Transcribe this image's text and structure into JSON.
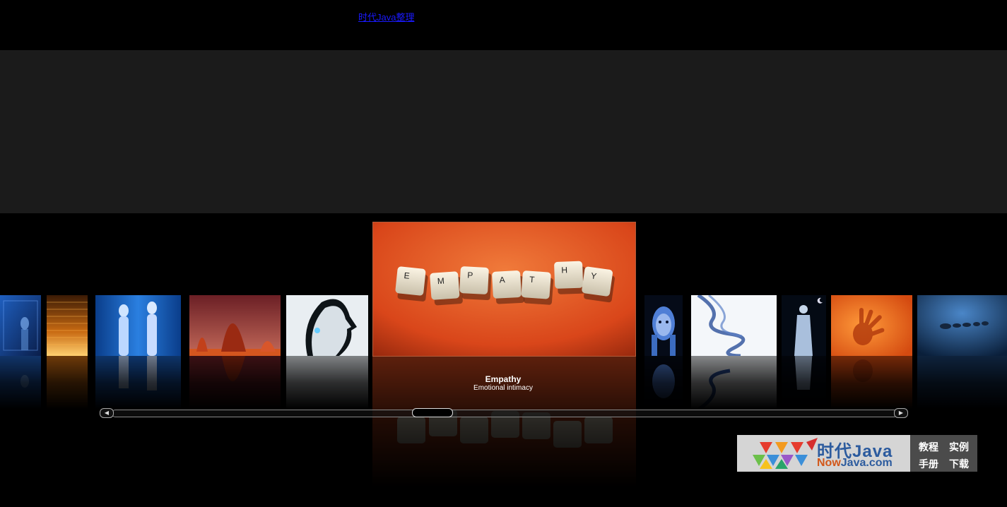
{
  "header": {
    "link_text": "时代Java整理"
  },
  "gallery": {
    "items": [
      {
        "name": "blue-glass-figure-thumbnail"
      },
      {
        "name": "orange-code-thumbnail"
      },
      {
        "name": "blue-mannequins-thumbnail"
      },
      {
        "name": "red-cone-landscape-thumbnail"
      },
      {
        "name": "white-face-profile-thumbnail"
      },
      {
        "name": "empathy-keys-thumbnail"
      },
      {
        "name": "blue-face-hands-thumbnail"
      },
      {
        "name": "blue-smoke-thumbnail"
      },
      {
        "name": "ghost-figure-thumbnail"
      },
      {
        "name": "orange-hand-thumbnail"
      },
      {
        "name": "blue-stones-thumbnail"
      }
    ],
    "selected": {
      "title": "Empathy",
      "subtitle": "Emotional intimacy",
      "keys": [
        "E",
        "M",
        "P",
        "A",
        "T",
        "H",
        "Y"
      ]
    }
  },
  "scrollbar": {
    "left_icon": "arrow-left-icon",
    "right_icon": "arrow-right-icon"
  },
  "watermark": {
    "title": "时代Java",
    "url_prefix": "Now",
    "url_suffix": "Java.com",
    "links": [
      "教程",
      "实例",
      "手册",
      "下载"
    ]
  },
  "colors": {
    "background": "#000000",
    "band": "#1b1b1b",
    "accent_orange": "#e0541b",
    "logo_blue": "#2c5b9e"
  }
}
